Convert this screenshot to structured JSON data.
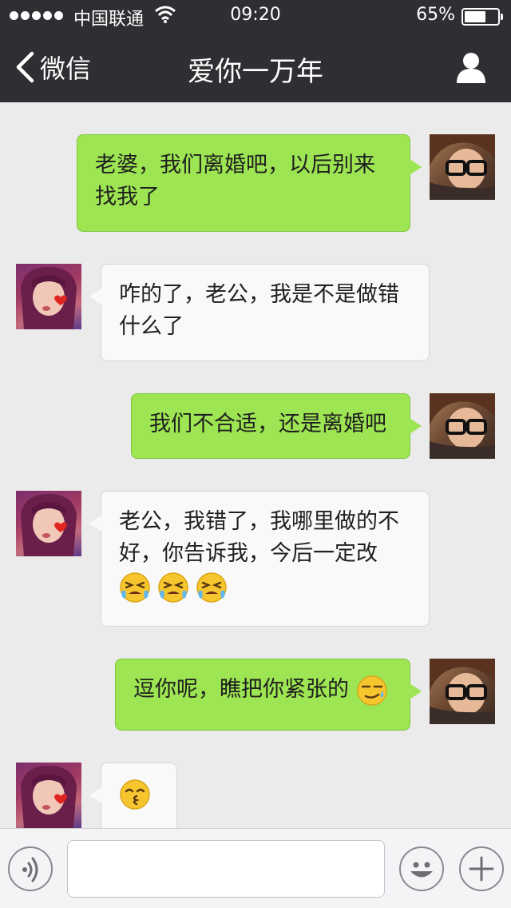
{
  "status_bar": {
    "carrier": "中国联通",
    "time": "09:20",
    "battery_percent": "65%",
    "battery_level": 0.65,
    "signal_dots": 5,
    "wifi_icon": "wifi-icon"
  },
  "nav": {
    "back_label": "微信",
    "back_icon": "chevron-left-icon",
    "title": "爱你一万年",
    "profile_icon": "person-icon"
  },
  "messages": [
    {
      "sender": "me",
      "text": "老婆，我们离婚吧，以后别来找我了"
    },
    {
      "sender": "her",
      "text": "咋的了，老公，我是不是做错什么了"
    },
    {
      "sender": "me",
      "text": "我们不合适，还是离婚吧"
    },
    {
      "sender": "her",
      "text": "老公，我错了，我哪里做的不好，你告诉我，今后一定改",
      "emojis": [
        "crying-face-emoji",
        "crying-face-emoji",
        "crying-face-emoji"
      ]
    },
    {
      "sender": "me",
      "text": "逗你呢，瞧把你紧张的",
      "emojis": [
        "smirk-sweat-emoji"
      ]
    },
    {
      "sender": "her",
      "text": "",
      "emojis": [
        "kissing-face-emoji"
      ]
    }
  ],
  "input_bar": {
    "voice_icon": "voice-icon",
    "text_value": "",
    "emoji_icon": "smiley-icon",
    "plus_icon": "plus-icon"
  },
  "colors": {
    "nav_background": "#2f2f33",
    "chat_background": "#ebebeb",
    "my_bubble": "#9de552",
    "her_bubble": "#f9f9f9"
  }
}
